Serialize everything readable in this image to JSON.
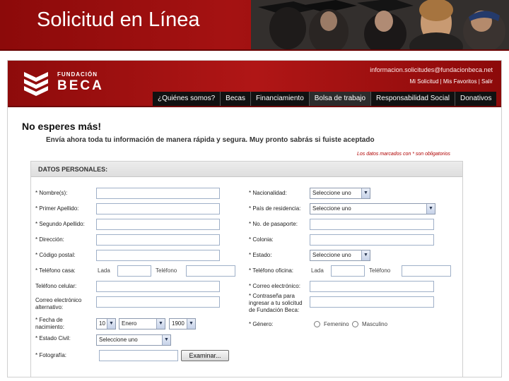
{
  "slide": {
    "title": "Solicitud en Línea"
  },
  "site": {
    "logo": {
      "small": "FUNDACIÓN",
      "big": "BECA"
    },
    "contact_email": "informacion.solicitudes@fundacionbeca.net",
    "utility_links": "Mi Solicitud | Mis Favoritos | Salir",
    "nav": [
      "¿Quiénes somos?",
      "Becas",
      "Financiamiento",
      "Bolsa de trabajo",
      "Responsabilidad Social",
      "Donativos"
    ],
    "headline": "No esperes más!",
    "subline": "Envía ahora toda tu información de manera rápida y segura. Muy pronto sabrás si fuiste aceptado",
    "required_note": "Los datos marcados con * son obligatorios"
  },
  "form": {
    "section_title": "DATOS PERSONALES:",
    "left": {
      "nombre": "* Nombre(s):",
      "primer_apellido": "* Primer Apellido:",
      "segundo_apellido": "* Segundo Apellido:",
      "direccion": "* Dirección:",
      "codigo_postal": "* Código postal:",
      "telefono_casa": "* Teléfono casa:",
      "lada": "Lada",
      "telefono": "Teléfono",
      "telefono_celular": "Teléfono celular:",
      "correo_alternativo": "Correo electrónico alternativo:",
      "fecha_nacimiento": "* Fecha de nacimiento:",
      "dia_value": "10",
      "mes_value": "Enero",
      "anio_value": "1900",
      "estado_civil": "* Estado Civil:",
      "estado_civil_value": "Seleccione uno",
      "fotografia": "* Fotografía:",
      "examinar": "Examinar..."
    },
    "right": {
      "nacionalidad": "* Nacionalidad:",
      "nacionalidad_value": "Seleccione uno",
      "pais_residencia": "* País de residencia:",
      "pais_residencia_value": "Seleccione uno",
      "pasaporte": "* No. de pasaporte:",
      "colonia": "* Colonia:",
      "estado": "* Estado:",
      "estado_value": "Seleccione uno",
      "telefono_oficina": "* Teléfono oficina:",
      "lada": "Lada",
      "telefono": "Teléfono",
      "correo": "* Correo electrónico:",
      "contrasena": "* Contraseña para ingresar a tu solicitud de Fundación Beca:",
      "genero": "* Género:",
      "femenino": "Femenino",
      "masculino": "Masculino"
    }
  }
}
